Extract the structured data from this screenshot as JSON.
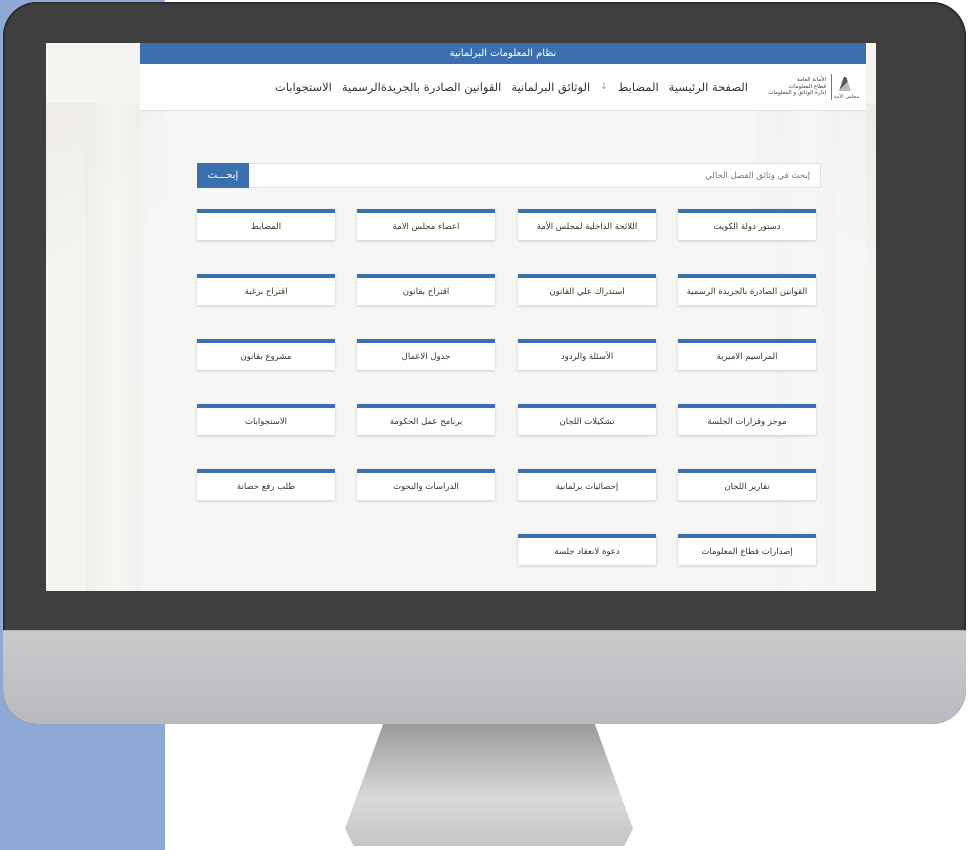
{
  "header": {
    "system_title": "نظام المعلومات البرلمانية"
  },
  "logo": {
    "lines": [
      "الأمانة العامة",
      "قطاع المعلومات",
      "إدارة الوثائق و المعلومات"
    ],
    "mark_caption": "مجلس الأمة"
  },
  "nav": {
    "items": [
      "الصفحة الرئيسية",
      "المضابط",
      "الوثائق البرلمانية",
      "القوانين الصادرة بالجريدةالرسمية",
      "الاستجوابات"
    ],
    "dropdown_glyph": "↓"
  },
  "search": {
    "placeholder": "إبحث في وثائق الفصل الحالي",
    "button_label": "إبحـــث"
  },
  "tiles": [
    "دستور دولة الكويت",
    "اللائحة الداخلية لمجلس الأمة",
    "اعضاء مجلس الامة",
    "المضابط",
    "القوانين الصادرة بالجريدة الرسمية",
    "استدراك علي القانون",
    "اقتراح بقانون",
    "اقتراح برغبة",
    "المراسيم الاميرية",
    "الأسئلة والردود",
    "جدول الاعمال",
    "مشروع بقانون",
    "موجز وقرارات الجلسة",
    "تشكيلات اللجان",
    "برنامج عمل الحكومة",
    "الاستجوابات",
    "تقارير اللجان",
    "إحصائيات برلمانية",
    "الدراسات والبحوث",
    "طلب رفع حصانة",
    "إصدارات قطاع المعلومات",
    "دعوة لانعقاد جلسة"
  ],
  "colors": {
    "accent": "#3b6fb0",
    "side_band": "#8ea9d6",
    "monitor_frame": "#3f3f3f"
  }
}
